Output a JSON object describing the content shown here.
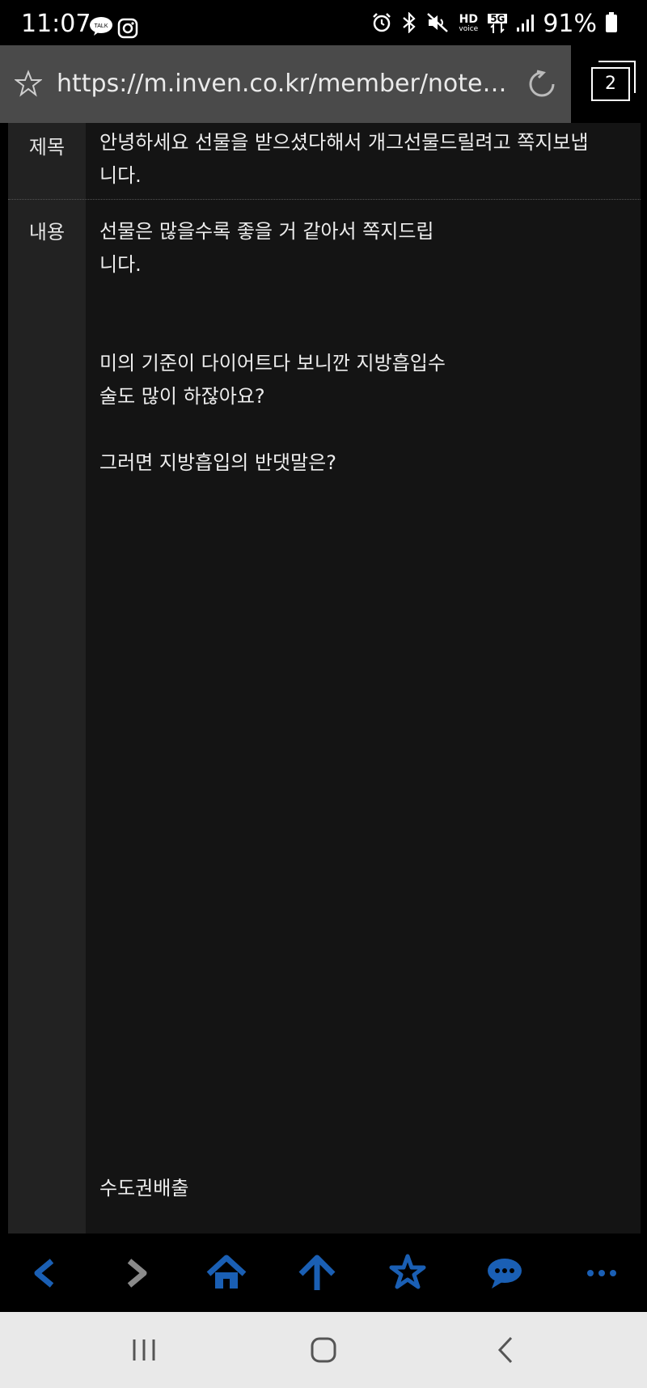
{
  "status_bar": {
    "time": "11:07",
    "battery_percent": "91%",
    "icons": [
      "kakaotalk-icon",
      "instagram-icon",
      "alarm-icon",
      "bluetooth-icon",
      "mute-icon",
      "hd-voice-icon",
      "5g-icon",
      "signal-icon",
      "battery-icon"
    ],
    "network_label": "5G",
    "hd_label": "HD",
    "voice_label": "voice",
    "talk_label": "TALK"
  },
  "browser": {
    "url": "https://m.inven.co.kr/member/note/?a...",
    "tab_count": "2"
  },
  "message": {
    "subject_label": "제목",
    "subject_line1": "안녕하세요 선물을 받으셨다해서 개그선물드릴려고 쪽지보냅",
    "subject_line2": "니다.",
    "content_label": "내용",
    "content_lines": [
      "선물은 많을수록 좋을 거 같아서 쪽지드립",
      "니다.",
      "미의 기준이 다이어트다 보니깐 지방흡입수",
      "술도 많이 하잖아요?",
      "그러면 지방흡입의 반댓말은?",
      "수도권배출"
    ]
  },
  "toolbar": {
    "accent": "#1a5fb4",
    "items": [
      "back-icon",
      "forward-icon",
      "home-icon",
      "scroll-top-icon",
      "bookmarks-icon",
      "chat-icon",
      "more-icon"
    ]
  },
  "navbar": {
    "items": [
      "recent-apps-icon",
      "home-circle-icon",
      "back-nav-icon"
    ]
  }
}
